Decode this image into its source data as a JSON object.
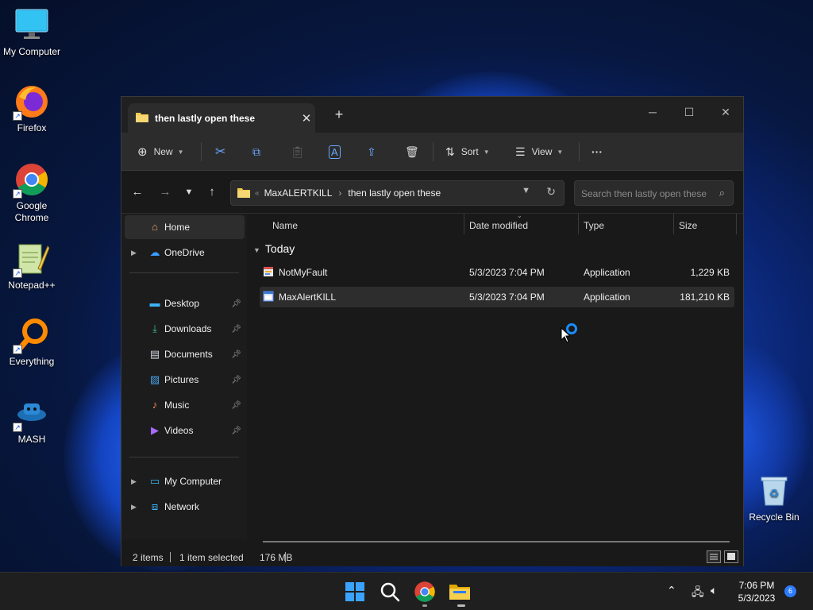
{
  "desktop": {
    "icons": [
      {
        "label": "My Computer"
      },
      {
        "label": "Firefox"
      },
      {
        "label": "Google Chrome"
      },
      {
        "label": "Notepad++"
      },
      {
        "label": "Everything"
      },
      {
        "label": "MASH"
      },
      {
        "label": "Recycle Bin"
      }
    ]
  },
  "explorer": {
    "tab_title": "then lastly open these",
    "toolbar": {
      "new_label": "New",
      "sort_label": "Sort",
      "view_label": "View",
      "more_label": "···"
    },
    "address": {
      "crumbs": [
        "MaxALERTKILL",
        "then lastly open these"
      ]
    },
    "search": {
      "placeholder": "Search then lastly open these"
    },
    "sidebar": {
      "items": [
        {
          "label": "Home"
        },
        {
          "label": "OneDrive"
        },
        {
          "label": "Desktop"
        },
        {
          "label": "Downloads"
        },
        {
          "label": "Documents"
        },
        {
          "label": "Pictures"
        },
        {
          "label": "Music"
        },
        {
          "label": "Videos"
        },
        {
          "label": "My Computer"
        },
        {
          "label": "Network"
        }
      ]
    },
    "columns": {
      "name": "Name",
      "date": "Date modified",
      "type": "Type",
      "size": "Size"
    },
    "group": "Today",
    "files": [
      {
        "name": "NotMyFault",
        "date": "5/3/2023 7:04 PM",
        "type": "Application",
        "size": "1,229 KB"
      },
      {
        "name": "MaxAlertKILL",
        "date": "5/3/2023 7:04 PM",
        "type": "Application",
        "size": "181,210 KB"
      }
    ],
    "status": {
      "items": "2 items",
      "selected": "1 item selected",
      "size": "176 MB"
    }
  },
  "taskbar": {
    "time": "7:06 PM",
    "date": "5/3/2023",
    "notification_count": "6"
  },
  "colors": {
    "accent": "#1b8cff",
    "window_bg": "#191919",
    "taskbar_bg": "#1f1f1f"
  }
}
